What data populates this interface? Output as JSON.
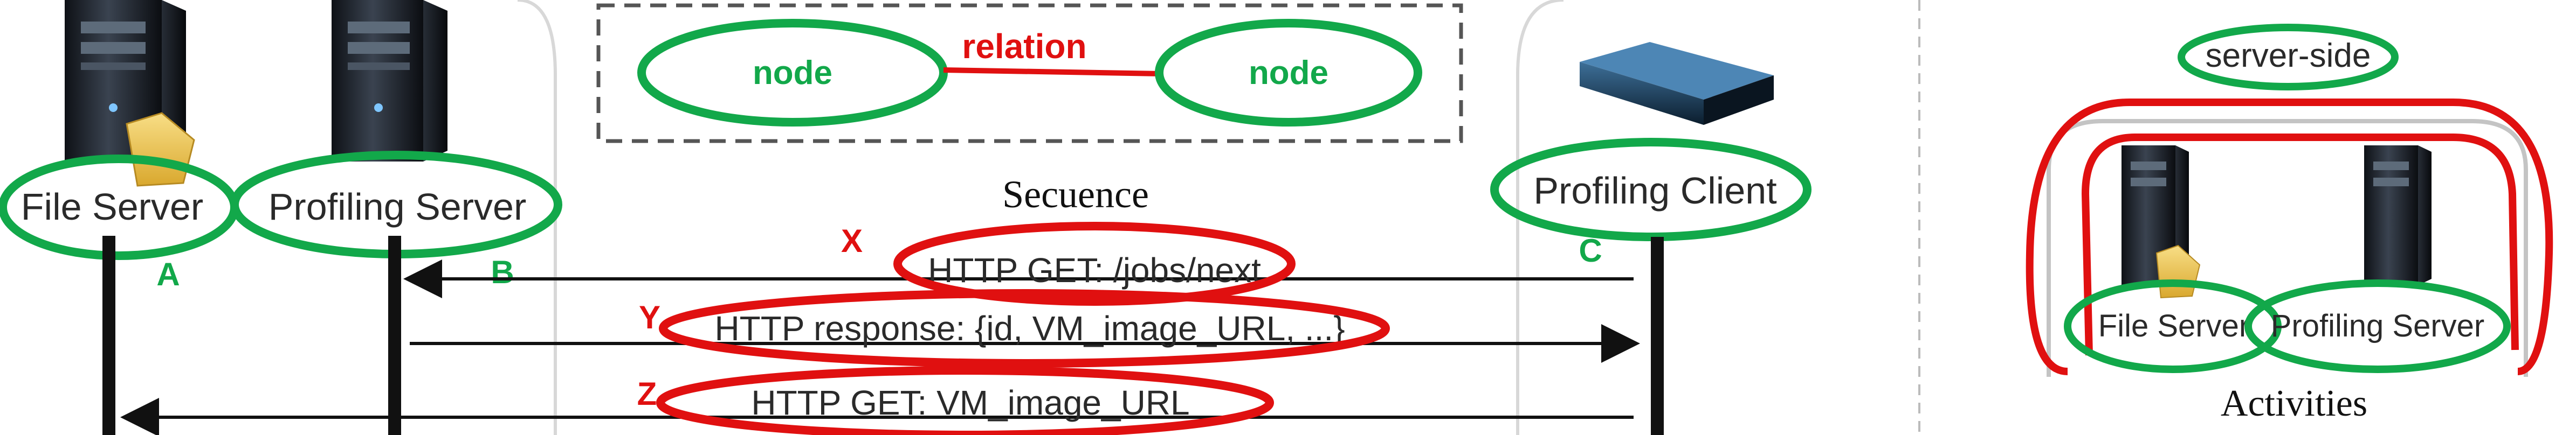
{
  "legend": {
    "node_left": "node",
    "node_right": "node",
    "relation": "relation"
  },
  "sequence": {
    "title": "Secuence",
    "actors": {
      "file_server": "File Server",
      "profiling_server": "Profiling Server",
      "profiling_client": "Profiling Client"
    },
    "markers": {
      "a": "A",
      "b": "B",
      "c": "C"
    },
    "messages": [
      {
        "marker": "X",
        "text": "HTTP GET: /jobs/next"
      },
      {
        "marker": "Y",
        "text": "HTTP response: {id, VM_image_URL, ...}"
      },
      {
        "marker": "Z",
        "text": "HTTP GET: VM_image_URL"
      }
    ]
  },
  "activities": {
    "group_label": "server-side",
    "file_server": "File Server",
    "profiling_server": "Profiling Server",
    "title": "Activities"
  },
  "colors": {
    "green": "#12a84a",
    "red": "#e01010",
    "line": "#111111"
  },
  "icons": [
    "server-tower-icon",
    "folder-icon",
    "client-device-icon"
  ]
}
